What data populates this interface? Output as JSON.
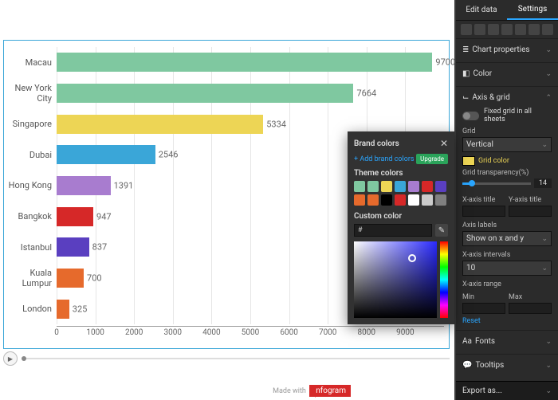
{
  "chart_data": {
    "type": "bar",
    "orientation": "horizontal",
    "categories": [
      "Macau",
      "New York City",
      "Singapore",
      "Dubai",
      "Hong Kong",
      "Bangkok",
      "Istanbul",
      "Kuala Lumpur",
      "London"
    ],
    "values": [
      9700,
      7664,
      5334,
      2546,
      1391,
      947,
      837,
      700,
      325
    ],
    "colors": [
      "#7fc8a0",
      "#7fc8a0",
      "#edd555",
      "#3aa6d8",
      "#a87ccf",
      "#d62828",
      "#5a3fc0",
      "#e66a2c",
      "#e66a2c"
    ],
    "xlim": [
      0,
      10000
    ],
    "xticks": [
      0,
      1000,
      2000,
      3000,
      4000,
      5000,
      6000,
      7000,
      8000,
      9000
    ],
    "title": "",
    "xlabel": "",
    "ylabel": ""
  },
  "footer": {
    "madewith": "Made with",
    "brand": "infogram"
  },
  "tabs": {
    "edit": "Edit data",
    "settings": "Settings"
  },
  "panel": {
    "chart_properties": "Chart properties",
    "color": "Color",
    "axis_grid": "Axis & grid",
    "fixed_grid": "Fixed grid in all sheets",
    "grid_label": "Grid",
    "grid_mode": "Vertical",
    "grid_color_label": "Grid color",
    "grid_transparency_label": "Grid transparency(%)",
    "grid_transparency_value": "14",
    "x_axis_title": "X-axis title",
    "y_axis_title": "Y-axis title",
    "axis_labels": "Axis labels",
    "axis_labels_value": "Show on x and y",
    "x_intervals": "X-axis intervals",
    "x_intervals_value": "10",
    "x_range": "X-axis range",
    "min": "Min",
    "max": "Max",
    "reset": "Reset",
    "fonts": "Fonts",
    "tooltips": "Tooltips",
    "export": "Export as..."
  },
  "popover": {
    "brand_colors": "Brand colors",
    "add_brand": "+  Add brand colors",
    "upgrade": "Upgrade",
    "theme_colors": "Theme colors",
    "custom_color": "Custom color",
    "hash": "#",
    "theme_swatches": [
      "#7fc8a0",
      "#7fc8a0",
      "#edd555",
      "#3aa6d8",
      "#a87ccf",
      "#d62828",
      "#5a3fc0",
      "#e66a2c",
      "#e66a2c",
      "#000000",
      "#d62828",
      "#ffffff",
      "#cccccc",
      "#808080"
    ]
  }
}
